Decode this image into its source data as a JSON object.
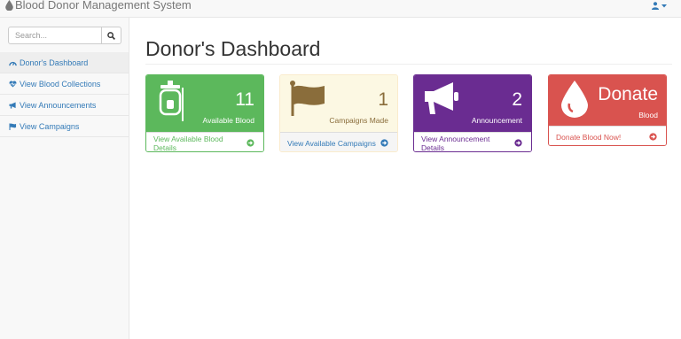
{
  "app": {
    "title": "Blood Donor Management System"
  },
  "search": {
    "placeholder": "Search..."
  },
  "sidebar": {
    "items": [
      {
        "label": "Donor's Dashboard",
        "icon": "dashboard-icon",
        "active": true
      },
      {
        "label": "View Blood Collections",
        "icon": "heartbeat-icon"
      },
      {
        "label": "View Announcements",
        "icon": "bullhorn-icon"
      },
      {
        "label": "View Campaigns",
        "icon": "flag-icon"
      }
    ]
  },
  "main": {
    "title": "Donor's Dashboard",
    "panels": [
      {
        "count": "11",
        "label": "Available Blood",
        "link": "View Available Blood Details",
        "icon": "blood-bag-icon",
        "color": "#5cb85c"
      },
      {
        "count": "1",
        "label": "Campaigns Made",
        "link": "View Available Campaigns",
        "icon": "flag-icon",
        "color": "#fcf8e3"
      },
      {
        "count": "2",
        "label": "Announcement",
        "link": "View Announcement Details",
        "icon": "bullhorn-icon",
        "color": "#6a2c91"
      },
      {
        "word": "Donate",
        "label": "Blood",
        "link": "Donate Blood Now!",
        "icon": "blood-drop-icon",
        "color": "#d9534f"
      }
    ]
  },
  "colors": {
    "link": "#337ab7",
    "brand_text": "#777777"
  }
}
